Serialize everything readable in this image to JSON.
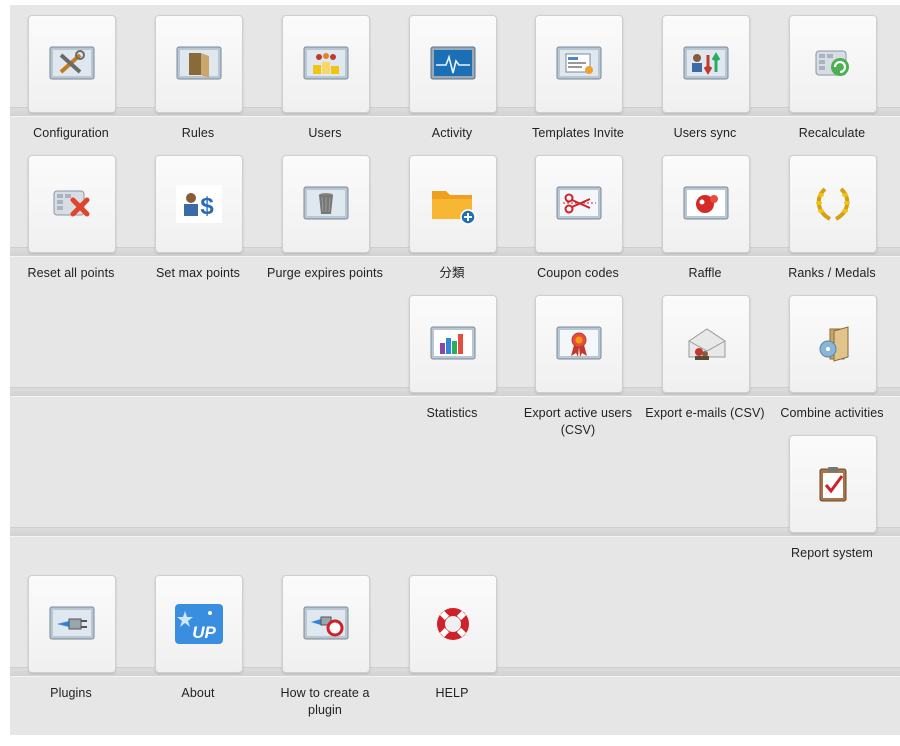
{
  "items": [
    {
      "label": "Configuration",
      "icon": "configuration-icon"
    },
    {
      "label": "Rules",
      "icon": "rules-book-icon"
    },
    {
      "label": "Users",
      "icon": "users-group-icon"
    },
    {
      "label": "Activity",
      "icon": "activity-monitor-icon"
    },
    {
      "label": "Templates Invite",
      "icon": "templates-invite-icon"
    },
    {
      "label": "Users sync",
      "icon": "users-sync-icon"
    },
    {
      "label": "Recalculate",
      "icon": "recalculate-icon"
    },
    {
      "label": "Reset all points",
      "icon": "reset-points-icon"
    },
    {
      "label": "Set max points",
      "icon": "set-max-points-icon"
    },
    {
      "label": "Purge expires points",
      "icon": "purge-trash-icon"
    },
    {
      "label": "分類",
      "icon": "folder-add-icon"
    },
    {
      "label": "Coupon codes",
      "icon": "coupon-scissors-icon"
    },
    {
      "label": "Raffle",
      "icon": "raffle-icon"
    },
    {
      "label": "Ranks / Medals",
      "icon": "laurel-wreath-icon"
    },
    {
      "label": "Statistics",
      "icon": "statistics-chart-icon"
    },
    {
      "label": "Export active users (CSV)",
      "icon": "export-users-ribbon-icon"
    },
    {
      "label": "Export e-mails (CSV)",
      "icon": "export-emails-icon"
    },
    {
      "label": "Combine activities",
      "icon": "combine-activities-icon"
    },
    {
      "label": "Report system",
      "icon": "report-clipboard-icon"
    },
    {
      "label": "Plugins",
      "icon": "plugins-icon"
    },
    {
      "label": "About",
      "icon": "about-aup-logo-icon"
    },
    {
      "label": "How to create a plugin",
      "icon": "create-plugin-icon"
    },
    {
      "label": "HELP",
      "icon": "help-lifebuoy-icon"
    }
  ],
  "logo_text": "UP"
}
